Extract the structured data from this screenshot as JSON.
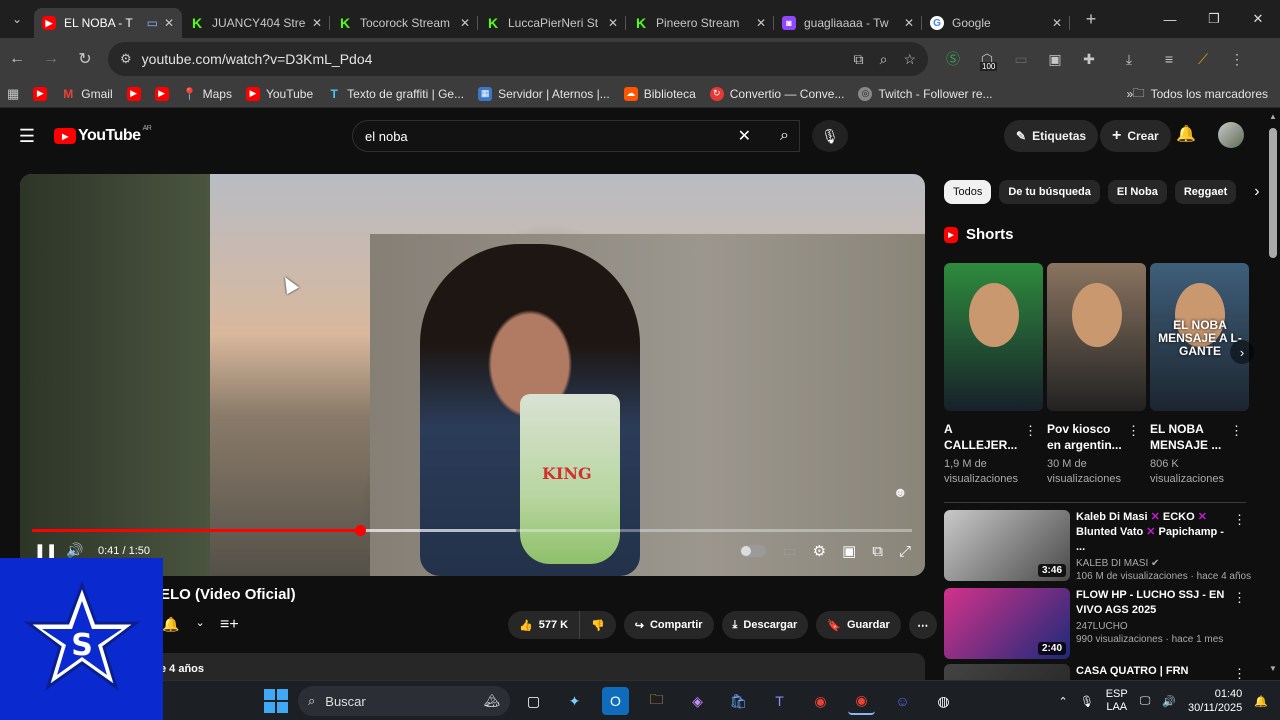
{
  "browser": {
    "tabs": [
      {
        "title": "EL NOBA - T",
        "icon": "youtube",
        "active": true
      },
      {
        "title": "JUANCY404 Stre",
        "icon": "kick"
      },
      {
        "title": "Tocorock Stream",
        "icon": "kick"
      },
      {
        "title": "LuccaPierNeri St",
        "icon": "kick"
      },
      {
        "title": "Pineero Stream",
        "icon": "kick"
      },
      {
        "title": "guagliaaaa - Tw",
        "icon": "twitch"
      },
      {
        "title": "Google",
        "icon": "google"
      }
    ],
    "url": "youtube.com/watch?v=D3KmL_Pdo4",
    "extension_badge": "100",
    "bookmarks": [
      {
        "label": "",
        "icon": "youtube"
      },
      {
        "label": "Gmail",
        "icon": "gmail"
      },
      {
        "label": "",
        "icon": "youtube"
      },
      {
        "label": "",
        "icon": "youtube"
      },
      {
        "label": "Maps",
        "icon": "maps"
      },
      {
        "label": "YouTube",
        "icon": "youtube"
      },
      {
        "label": "Texto de graffiti | Ge...",
        "icon": "text"
      },
      {
        "label": "Servidor | Aternos |...",
        "icon": "server"
      },
      {
        "label": "Biblioteca",
        "icon": "soundcloud"
      },
      {
        "label": "Convertio — Conve...",
        "icon": "convertio"
      },
      {
        "label": "Twitch - Follower re...",
        "icon": "globe"
      }
    ],
    "all_bookmarks": "Todos los marcadores"
  },
  "youtube": {
    "logo_text": "YouTube",
    "region": "AR",
    "search_value": "el noba",
    "etiquetas": "Etiquetas",
    "crear": "Crear",
    "player": {
      "current_time": "0:41",
      "total_time": "1:50",
      "time_display": "0:41 / 1:50",
      "progress_fraction": 0.373,
      "buffer_fraction": 0.55
    },
    "video_title": "ELO (Video Oficial)",
    "likes": "577 K",
    "share": "Compartir",
    "download": "Descargar",
    "save": "Guardar",
    "date": "e 4 años",
    "chips": [
      {
        "label": "Todos",
        "active": true
      },
      {
        "label": "De tu búsqueda"
      },
      {
        "label": "El Noba"
      },
      {
        "label": "Reggaet"
      }
    ],
    "shorts_heading": "Shorts",
    "shorts": [
      {
        "title": "A CALLEJER...",
        "views": "1,9 M de visualizaciones",
        "overlay": "",
        "colors": [
          "#2e8b3d",
          "#17202a"
        ]
      },
      {
        "title": "Pov kiosco en argentin...",
        "views": "30 M de visualizaciones",
        "overlay": "",
        "colors": [
          "#8a7460",
          "#222"
        ]
      },
      {
        "title": "EL NOBA MENSAJE ...",
        "views": "806 K visualizaciones",
        "overlay": "EL NOBA MENSAJE A L-GANTE",
        "colors": [
          "#3f5f7a",
          "#1c2530"
        ]
      }
    ],
    "recommendations": [
      {
        "title_parts": [
          "Kaleb Di Masi ",
          "✕",
          " ECKO ",
          "✕",
          " Blunted Vato ",
          "✕",
          " Papichamp - ..."
        ],
        "channel": "KALEB DI MASI",
        "verified": true,
        "meta": "106 M de visualizaciones · hace 4 años",
        "duration": "3:46",
        "colors": [
          "#c9c9c9",
          "#4a4a4a"
        ]
      },
      {
        "title": "FLOW HP - LUCHO SSJ - EN VIVO AGS 2025",
        "channel": "247LUCHO",
        "verified": false,
        "meta": "990 visualizaciones · hace 1 mes",
        "duration": "2:40",
        "colors": [
          "#d4328a",
          "#1b2a7a"
        ]
      },
      {
        "title": "CASA QUATRO | FRN",
        "channel": "",
        "verified": false,
        "meta": "",
        "duration": "",
        "colors": [
          "#444",
          "#222"
        ]
      }
    ]
  },
  "taskbar": {
    "search_placeholder": "Buscar",
    "lang_line1": "ESP",
    "lang_line2": "LAA",
    "time": "01:40",
    "date": "30/11/2025"
  },
  "colors": {
    "accent_red": "#ff0000",
    "overlay_blue": "#0a2ad0"
  }
}
